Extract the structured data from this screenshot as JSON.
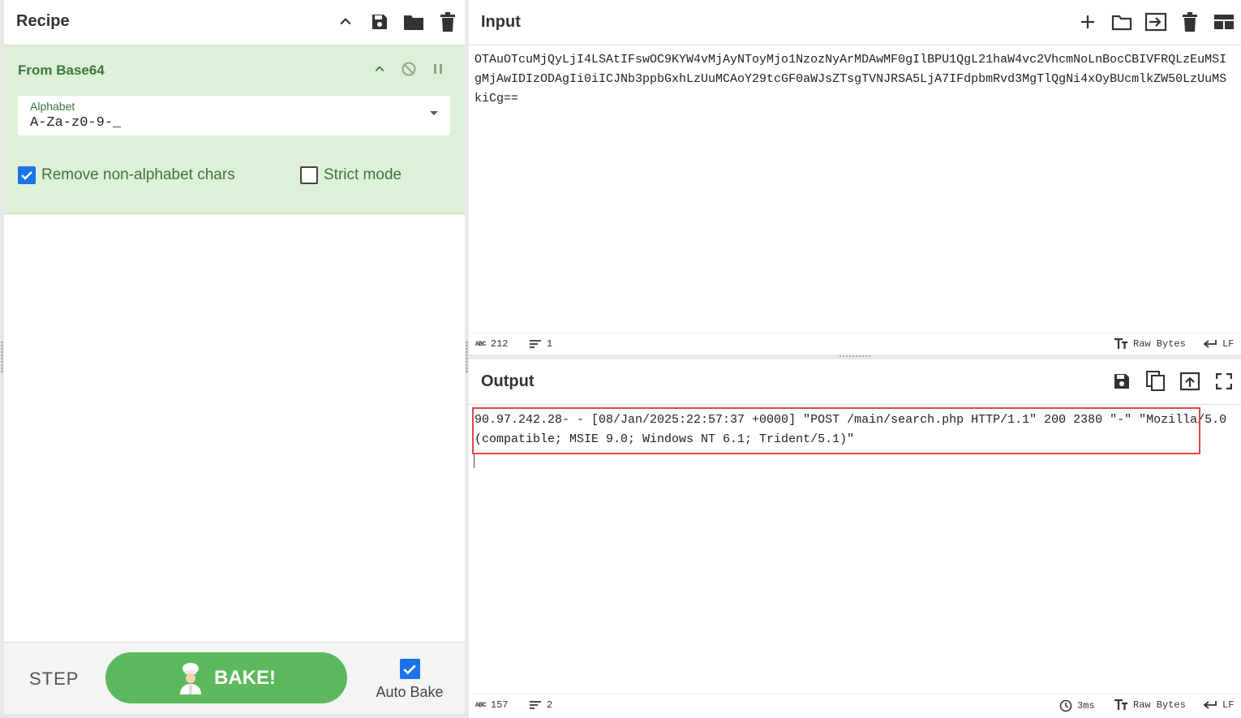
{
  "recipe": {
    "title": "Recipe",
    "operation": {
      "title": "From Base64",
      "alphabet_label": "Alphabet",
      "alphabet_value": "A-Za-z0-9-_",
      "remove_non_alphabet_label": "Remove non-alphabet chars",
      "remove_non_alphabet_checked": true,
      "strict_mode_label": "Strict mode",
      "strict_mode_checked": false
    },
    "footer": {
      "step_label": "STEP",
      "bake_label": "BAKE!",
      "auto_bake_label": "Auto Bake",
      "auto_bake_checked": true
    }
  },
  "input": {
    "title": "Input",
    "text": "OTAuOTcuMjQyLjI4LSAtIFswOC9KYW4vMjAyNToyMjo1NzozNyArMDAwMF0gIlBPU1QgL21haW4vc2VhcmNoLnBocCBIVFRQLzEuMSIgMjAwIDIzODAgIi0iICJNb3ppbGxhLzUuMCAoY29tcGF0aWJsZTsgTVNJRSA5LjA7IFdpbmRvd3MgTlQgNi4xOyBUcmlkZW50LzUuMSkiCg==",
    "status": {
      "chars": "212",
      "lines": "1",
      "encoding": "Raw Bytes",
      "eol": "LF"
    }
  },
  "output": {
    "title": "Output",
    "text": "90.97.242.28- - [08/Jan/2025:22:57:37 +0000] \"POST /main/search.php HTTP/1.1\" 200 2380 \"-\" \"Mozilla/5.0 (compatible; MSIE 9.0; Windows NT 6.1; Trident/5.1)\"",
    "status": {
      "chars": "157",
      "lines": "2",
      "time": "3ms",
      "encoding": "Raw Bytes",
      "eol": "LF"
    }
  },
  "colors": {
    "accent_green": "#5cb85c",
    "operation_bg": "#dff0d8",
    "operation_text": "#3c763d",
    "checkbox_blue": "#1a73e8",
    "highlight_red": "#e04848"
  }
}
